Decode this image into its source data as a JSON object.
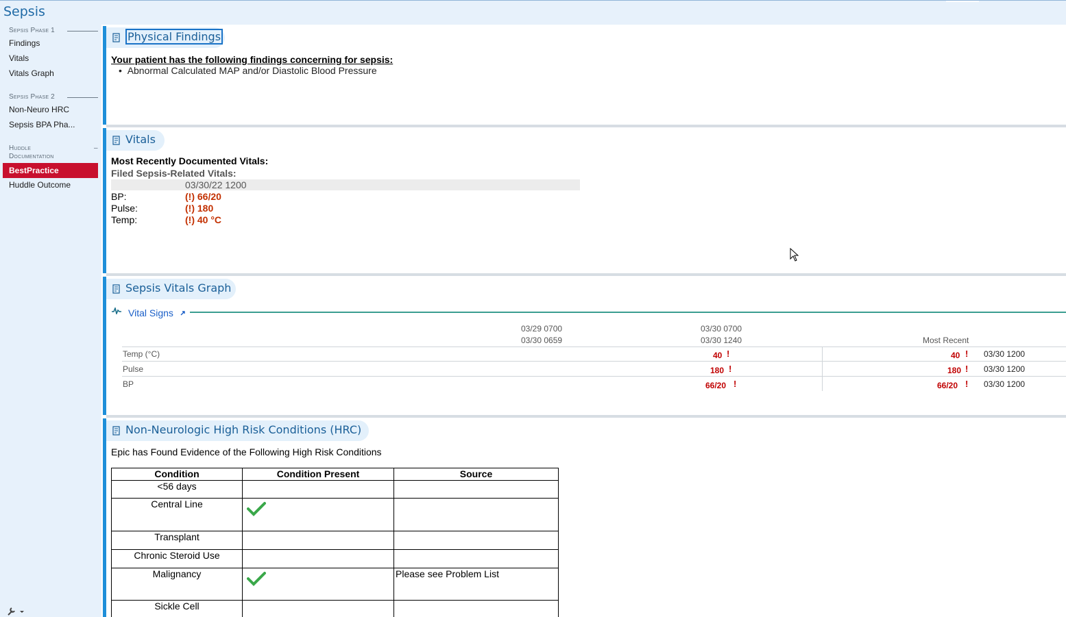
{
  "app": {
    "title": "Sepsis"
  },
  "sidebar": {
    "groups": [
      {
        "label": "Sepsis Phase 1",
        "items": [
          "Findings",
          "Vitals",
          "Vitals Graph"
        ]
      },
      {
        "label": "Sepsis Phase 2",
        "items": [
          "Non-Neuro HRC",
          "Sepsis BPA Pha..."
        ]
      },
      {
        "label_line1": "Huddle",
        "label_line2": "Documentation",
        "collapse_symbol": "–",
        "items": [
          "BestPractice",
          "Huddle Outcome"
        ],
        "active": "BestPractice"
      }
    ],
    "tool_icon": "wrench-icon"
  },
  "findings": {
    "title": "Physical Findings",
    "heading": "Your patient has the following findings concerning for sepsis:",
    "bullets": [
      "Abnormal Calculated MAP and/or Diastolic Blood Pressure"
    ]
  },
  "vitals": {
    "title": "Vitals",
    "heading": "Most Recently Documented Vitals:",
    "subheading": "Filed Sepsis-Related Vitals:",
    "column_time": "03/30/22 1200",
    "rows": [
      {
        "label": "BP:",
        "value": "(!) 66/20"
      },
      {
        "label": "Pulse:",
        "value": "(!) 180"
      },
      {
        "label": "Temp:",
        "value": "(!) 40 °C"
      }
    ]
  },
  "vitals_graph": {
    "title": "Sepsis Vitals Graph",
    "subsection": "Vital Signs",
    "columns": [
      {
        "line1": "03/29 0700",
        "line2": "03/30 0659"
      },
      {
        "line1": "03/30 0700",
        "line2": "03/30 1240"
      },
      {
        "line1": "",
        "line2": "Most Recent"
      }
    ],
    "rows": [
      {
        "label": "Temp (°C)",
        "col2": "40",
        "recent": "40",
        "recent_time": "03/30 1200"
      },
      {
        "label": "Pulse",
        "col2": "180",
        "recent": "180",
        "recent_time": "03/30 1200"
      },
      {
        "label": "BP",
        "col2": "66/20",
        "recent": "66/20",
        "recent_time": "03/30 1200"
      }
    ],
    "alert_mark": "!"
  },
  "hrc": {
    "title": "Non-Neurologic High Risk Conditions (HRC)",
    "intro": "Epic has Found Evidence of the Following High Risk Conditions",
    "headers": [
      "Condition",
      "Condition Present",
      "Source"
    ],
    "rows": [
      {
        "condition": "<56 days",
        "present": false,
        "source": ""
      },
      {
        "condition": "Central Line",
        "present": true,
        "source": ""
      },
      {
        "condition": "Transplant",
        "present": false,
        "source": ""
      },
      {
        "condition": "Chronic Steroid Use",
        "present": false,
        "source": ""
      },
      {
        "condition": "Malignancy",
        "present": true,
        "source": "Please see Problem List"
      },
      {
        "condition": "Sickle Cell",
        "present": false,
        "source": ""
      }
    ]
  },
  "colors": {
    "accent": "#1f8fd9",
    "active_nav": "#c8102e",
    "alert": "#c00000",
    "check": "#3aa84a",
    "title": "#1a5f98"
  }
}
